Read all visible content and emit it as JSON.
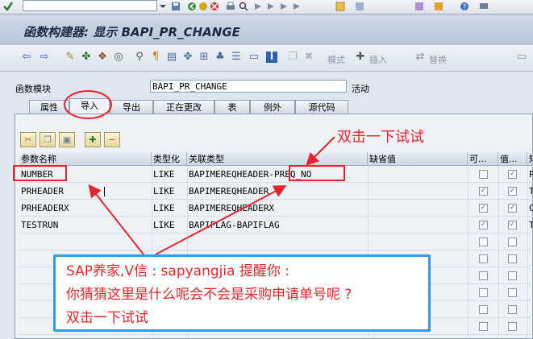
{
  "window": {
    "title": "函数构建器: 显示 BAPI_PR_CHANGE"
  },
  "app_toolbar": {
    "btn_pattern": "模式",
    "btn_insert": "插入",
    "btn_replace": "替换"
  },
  "header_fields": {
    "function_module_label": "函数模块",
    "function_module_value": "BAPI_PR_CHANGE",
    "status": "活动"
  },
  "tabs": [
    {
      "label": "属性"
    },
    {
      "label": "导入",
      "active": true
    },
    {
      "label": "导出"
    },
    {
      "label": "正在更改"
    },
    {
      "label": "表"
    },
    {
      "label": "例外"
    },
    {
      "label": "源代码"
    }
  ],
  "table": {
    "columns": [
      "参数名称",
      "类型化",
      "关联类型",
      "缺省值",
      "可...",
      "值...",
      "短"
    ],
    "rows": [
      {
        "name": "NUMBER",
        "typing": "LIKE",
        "assoc": "BAPIMEREQHEADER-PREQ_NO",
        "default": "",
        "optional": false,
        "pass_value": true,
        "desc": "P"
      },
      {
        "name": "PRHEADER",
        "typing": "LIKE",
        "assoc": "BAPIMEREQHEADER",
        "default": "",
        "optional": true,
        "pass_value": true,
        "desc": "T"
      },
      {
        "name": "PRHEADERX",
        "typing": "LIKE",
        "assoc": "BAPIMEREQHEADERX",
        "default": "",
        "optional": true,
        "pass_value": true,
        "desc": "C"
      },
      {
        "name": "TESTRUN",
        "typing": "LIKE",
        "assoc": "BAPIFLAG-BAPIFLAG",
        "default": "",
        "optional": true,
        "pass_value": true,
        "desc": "T"
      }
    ]
  },
  "annotations": {
    "note_top": "双击一下试试",
    "bubble_line1": "SAP养家,V信 : sapyangjia 提醒你 :",
    "bubble_line2": "你猜猜这里是什么呢会不会是采购申请单号呢 ?",
    "bubble_line3": "双击一下试试"
  },
  "colors": {
    "annotation_red": "#e8242b",
    "bubble_border": "#2f9ee8"
  }
}
